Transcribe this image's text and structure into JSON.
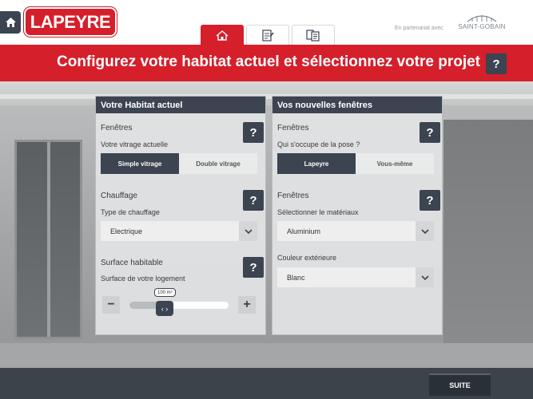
{
  "brand": {
    "name": "LAPEYRE",
    "partner_text": "En partenariat avec",
    "partner_name": "SAINT-GOBAIN",
    "red": "#d51f2b",
    "dark": "#3b4450"
  },
  "nav": {
    "home_icon": "home-icon",
    "tabs": [
      {
        "icon": "house-icon",
        "active": true
      },
      {
        "icon": "checklist-icon",
        "active": false
      },
      {
        "icon": "documents-icon",
        "active": false
      }
    ]
  },
  "banner": {
    "title": "Configurez votre habitat actuel et sélectionnez votre projet",
    "help": "?"
  },
  "left_panel": {
    "title": "Votre Habitat actuel",
    "windows": {
      "title": "Fenêtres",
      "subtitle": "Votre vitrage actuelle",
      "options": [
        "Simple vitrage",
        "Double vitrage"
      ],
      "selected": "Simple vitrage",
      "help": "?"
    },
    "heating": {
      "title": "Chauffage",
      "subtitle": "Type de chauffage",
      "value": "Electrique",
      "help": "?"
    },
    "surface": {
      "title": "Surface habitable",
      "subtitle": "Surface de votre logement",
      "value_label": "100 m²",
      "thumb_label": "‹ ›",
      "minus": "−",
      "plus": "+",
      "fraction": 0.32,
      "help": "?"
    }
  },
  "right_panel": {
    "title": "Vos nouvelles fenêtres",
    "pose": {
      "title": "Fenêtres",
      "subtitle": "Qui s'occupe de la pose ?",
      "options": [
        "Lapeyre",
        "Vous-même"
      ],
      "selected": "Lapeyre",
      "help": "?"
    },
    "material": {
      "title": "Fenêtres",
      "subtitle": "Sélectionner le matériaux",
      "value": "Aluminium",
      "help": "?"
    },
    "color": {
      "title": "Couleur extérieure",
      "value": "Blanc"
    }
  },
  "footer": {
    "next_label": "SUITE"
  }
}
